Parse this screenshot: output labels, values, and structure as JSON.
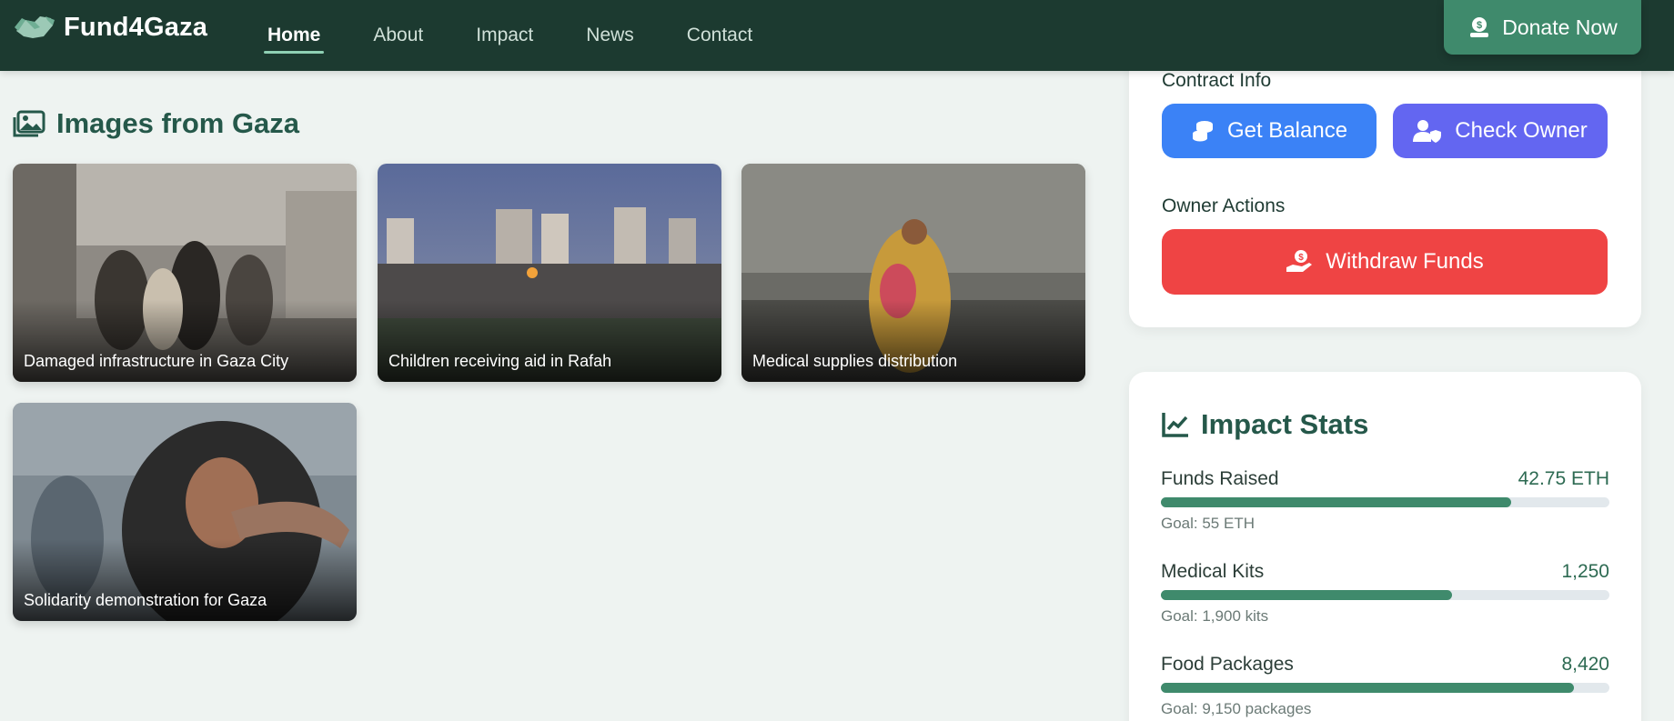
{
  "header": {
    "brand": "Fund4Gaza",
    "nav": [
      "Home",
      "About",
      "Impact",
      "News",
      "Contact"
    ],
    "active_nav": "Home",
    "donate_label": "Donate Now"
  },
  "gallery": {
    "title": "Images from Gaza",
    "images": [
      {
        "caption": "Damaged infrastructure in Gaza City"
      },
      {
        "caption": "Children receiving aid in Rafah"
      },
      {
        "caption": "Medical supplies distribution"
      },
      {
        "caption": "Solidarity demonstration for Gaza"
      }
    ]
  },
  "contract": {
    "section_label": "Contract Info",
    "get_balance_label": "Get Balance",
    "check_owner_label": "Check Owner",
    "owner_actions_label": "Owner Actions",
    "withdraw_label": "Withdraw Funds"
  },
  "stats": {
    "title": "Impact Stats",
    "items": [
      {
        "name": "Funds Raised",
        "value": "42.75 ETH",
        "goal": "Goal: 55 ETH",
        "progress": 0.78
      },
      {
        "name": "Medical Kits",
        "value": "1,250",
        "goal": "Goal: 1,900 kits",
        "progress": 0.65
      },
      {
        "name": "Food Packages",
        "value": "8,420",
        "goal": "Goal: 9,150 packages",
        "progress": 0.92
      }
    ]
  },
  "colors": {
    "header_bg": "#1c3a30",
    "accent_green": "#3f8a6c",
    "blue_button": "#3b82f6",
    "purple_button": "#6366f1",
    "red_button": "#ef4444"
  }
}
